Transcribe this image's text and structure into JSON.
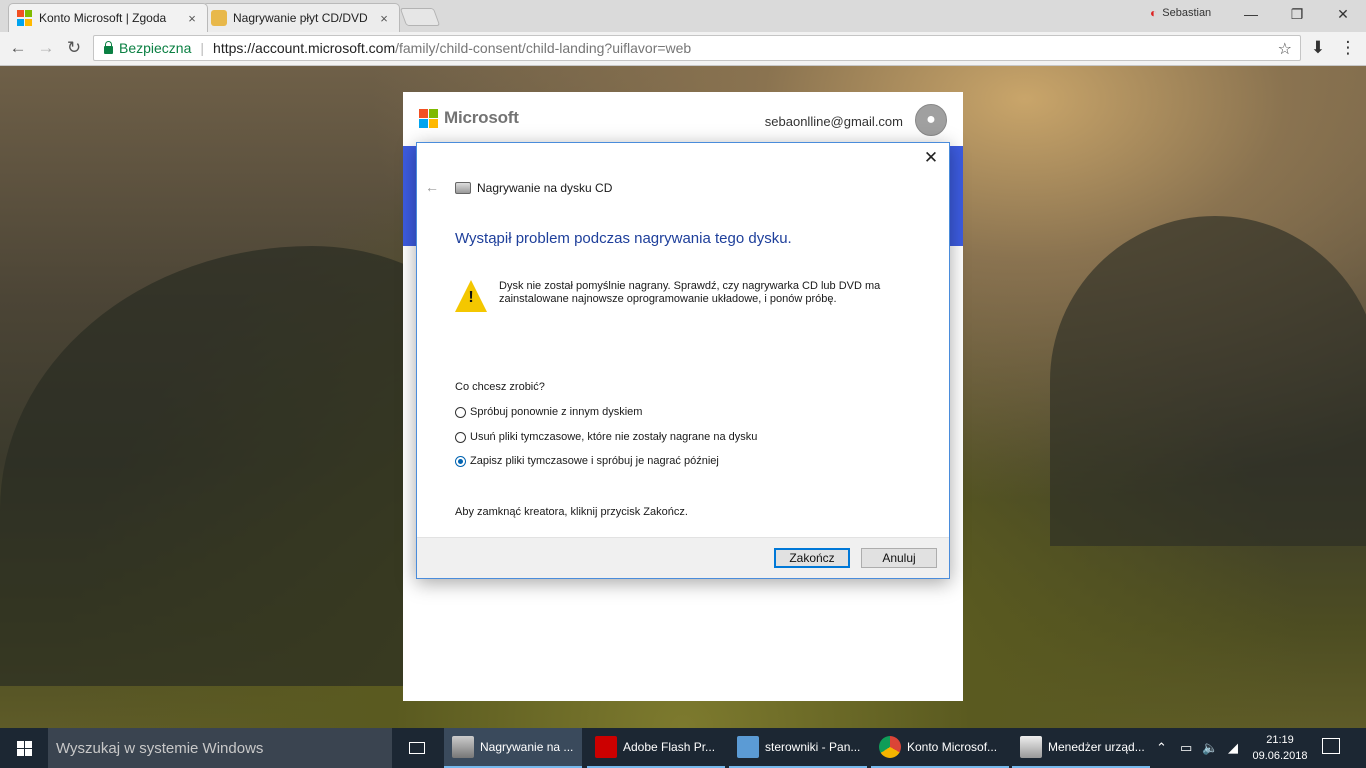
{
  "browser": {
    "tabs": [
      {
        "title": "Konto Microsoft | Zgoda",
        "close": "×"
      },
      {
        "title": "Nagrywanie płyt CD/DVD",
        "close": "×"
      }
    ],
    "profile_name": "Sebastian",
    "profile_icon": "profile-icon",
    "window_controls": {
      "minimize": "—",
      "maximize": "❐",
      "close": "✕"
    },
    "nav": {
      "back": "←",
      "forward": "→",
      "reload": "↻"
    },
    "address": {
      "secure_label": "Bezpieczna",
      "separator": "|",
      "url_host": "https://account.microsoft.com",
      "url_path": "/family/child-consent/child-landing?uiflavor=web"
    },
    "bookmark_icon": "☆",
    "download_icon": "⬇",
    "menu_icon": "⋮"
  },
  "ms_page": {
    "brand": "Microsoft",
    "email": "sebaonlline@gmail.com",
    "brand_colors": [
      "#f25022",
      "#7fba00",
      "#00a4ef",
      "#ffb900"
    ]
  },
  "dialog": {
    "close": "✕",
    "back": "←",
    "title": "Nagrywanie na dysku CD",
    "heading": "Wystąpił problem podczas nagrywania tego dysku.",
    "warning_mark": "!",
    "message": "Dysk nie został pomyślnie nagrany. Sprawdź, czy nagrywarka CD lub DVD ma zainstalowane najnowsze oprogramowanie układowe, i ponów próbę.",
    "question": "Co chcesz zrobić?",
    "options": [
      {
        "label": "Spróbuj ponownie z innym dyskiem",
        "selected": false
      },
      {
        "label": "Usuń pliki tymczasowe, które nie zostały nagrane na dysku",
        "selected": false
      },
      {
        "label": "Zapisz pliki tymczasowe i spróbuj je nagrać później",
        "selected": true
      }
    ],
    "note": "Aby zamknąć kreatora, kliknij przycisk Zakończ.",
    "buttons": {
      "finish": "Zakończ",
      "cancel": "Anuluj"
    }
  },
  "taskbar": {
    "search_placeholder": "Wyszukaj w systemie Windows",
    "items": [
      {
        "label": "Nagrywanie na ...",
        "icon": "cd-burn-icon",
        "active": true
      },
      {
        "label": "Adobe Flash Pr...",
        "icon": "adobe-icon",
        "active": false
      },
      {
        "label": "sterowniki - Pan...",
        "icon": "control-panel-icon",
        "active": false
      },
      {
        "label": "Konto Microsof...",
        "icon": "chrome-icon",
        "active": false
      },
      {
        "label": "Menedżer urząd...",
        "icon": "device-manager-icon",
        "active": false
      }
    ],
    "tray": {
      "chevron": "⌃",
      "battery": "▭",
      "volume": "🔈",
      "network": "◢"
    },
    "time": "21:19",
    "date": "09.06.2018"
  }
}
